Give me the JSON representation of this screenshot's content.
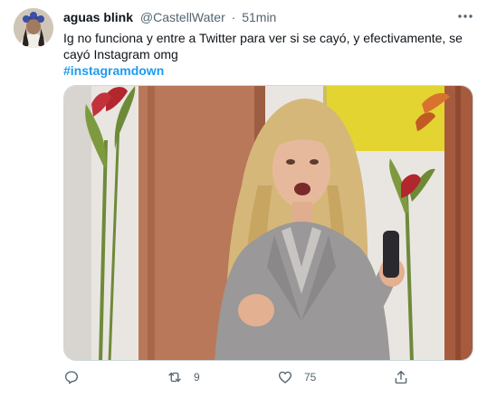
{
  "tweet": {
    "author_name": "aguas blink",
    "handle": "@CastellWater",
    "separator": "·",
    "time": "51min",
    "text_line1": "Ig no funciona y entre a Twitter para ver si se cayó, y efectivamente, se",
    "text_line2": "cayó Instagram omg",
    "hashtag": "#instagramdown"
  },
  "actions": {
    "retweets": "9",
    "likes": "75"
  },
  "icons": {
    "more": "more-horizontal-icon",
    "reply": "reply-icon",
    "retweet": "retweet-icon",
    "like": "heart-icon",
    "share": "share-icon"
  },
  "colors": {
    "accent": "#1d9bf0",
    "secondary_text": "#536471",
    "primary_text": "#0f1419"
  }
}
